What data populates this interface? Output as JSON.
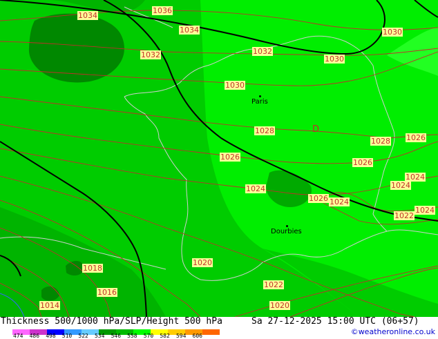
{
  "map": {
    "colors": {
      "land_green": "#00cc00",
      "bright_green": "#00ee00",
      "dark_green": "#009900",
      "darker_green": "#008800",
      "sea_green": "#00b400",
      "isobar": "#c0302a",
      "height_line": "#000000",
      "border": "#cfcfcf",
      "label_bg": "#ffff99"
    },
    "isobar_labels": [
      "1034",
      "1036",
      "1034",
      "1032",
      "1032",
      "1030",
      "1030",
      "1030",
      "1028",
      "1028",
      "1026",
      "1026",
      "1026",
      "1026",
      "1024",
      "1024",
      "1024",
      "1024",
      "1024",
      "1022",
      "1020",
      "1018",
      "1016",
      "1014",
      "1022",
      "1020"
    ],
    "pressure_system_symbol": "D",
    "cities": [
      {
        "name": "Paris"
      },
      {
        "name": "Dourbies"
      }
    ]
  },
  "footer": {
    "title": "Thickness 500/1000 hPa/SLP/Height 500 hPa",
    "datetime": "Sa 27-12-2025 15:00 UTC (06+57)",
    "credit": "©weatheronline.co.uk",
    "scale_ticks": [
      "474",
      "486",
      "498",
      "510",
      "522",
      "534",
      "546",
      "558",
      "570",
      "582",
      "594",
      "606"
    ],
    "scale_colors": [
      "#ff66ff",
      "#cc33cc",
      "#0000ff",
      "#3399ff",
      "#66ccff",
      "#009900",
      "#00bb00",
      "#00ff00",
      "#ffff00",
      "#ffcc00",
      "#ff9900",
      "#ff6600"
    ]
  }
}
